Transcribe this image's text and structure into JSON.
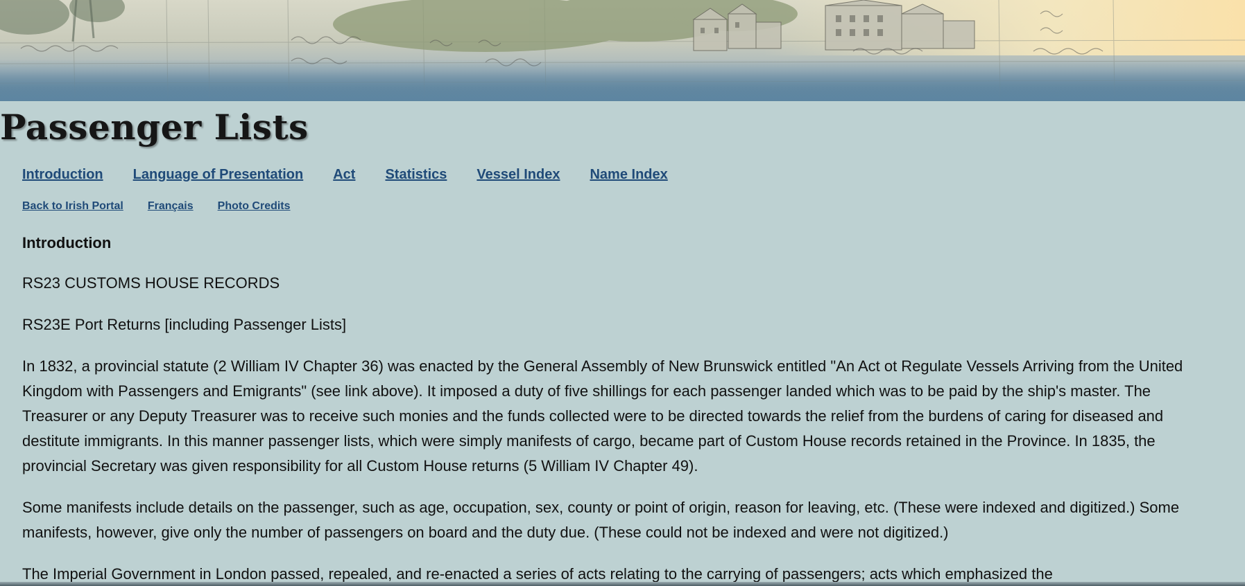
{
  "page": {
    "title": "Passenger Lists"
  },
  "nav_primary": [
    {
      "label": "Introduction"
    },
    {
      "label": "Language of Presentation"
    },
    {
      "label": "Act"
    },
    {
      "label": "Statistics"
    },
    {
      "label": "Vessel Index"
    },
    {
      "label": "Name Index"
    }
  ],
  "nav_secondary": [
    {
      "label": "Back to Irish Portal"
    },
    {
      "label": "Français"
    },
    {
      "label": "Photo Credits"
    }
  ],
  "content": {
    "heading": "Introduction",
    "line1": "RS23 CUSTOMS HOUSE RECORDS",
    "line2": "RS23E Port Returns [including Passenger Lists]",
    "para1": "In 1832, a provincial statute (2 William IV Chapter 36) was enacted by the General Assembly of New Brunswick entitled \"An Act ot Regulate Vessels Arriving from the United Kingdom with Passengers and Emigrants\" (see link above). It imposed a duty of five shillings for each passenger landed which was to be paid by the ship's master. The Treasurer or any Deputy Treasurer was to receive such monies and the funds collected were to be directed towards the relief from the burdens of caring for diseased and destitute immigrants. In this manner passenger lists, which were simply manifests of cargo, became part of Custom House records retained in the Province. In 1835, the provincial Secretary was given responsibility for all Custom House returns (5 William IV Chapter 49).",
    "para2": "Some manifests include details on the passenger, such as age, occupation, sex, county or point of origin, reason for leaving, etc. (These were indexed and digitized.) Some manifests, however, give only the number of passengers on board and the duty due. (These could not be indexed and were not digitized.)",
    "para3": "The Imperial Government in London passed, repealed, and re-enacted a series of acts relating to the carrying of passengers; acts which emphasized the"
  },
  "banner": {
    "icon": "historical-harbour-banner-image"
  }
}
